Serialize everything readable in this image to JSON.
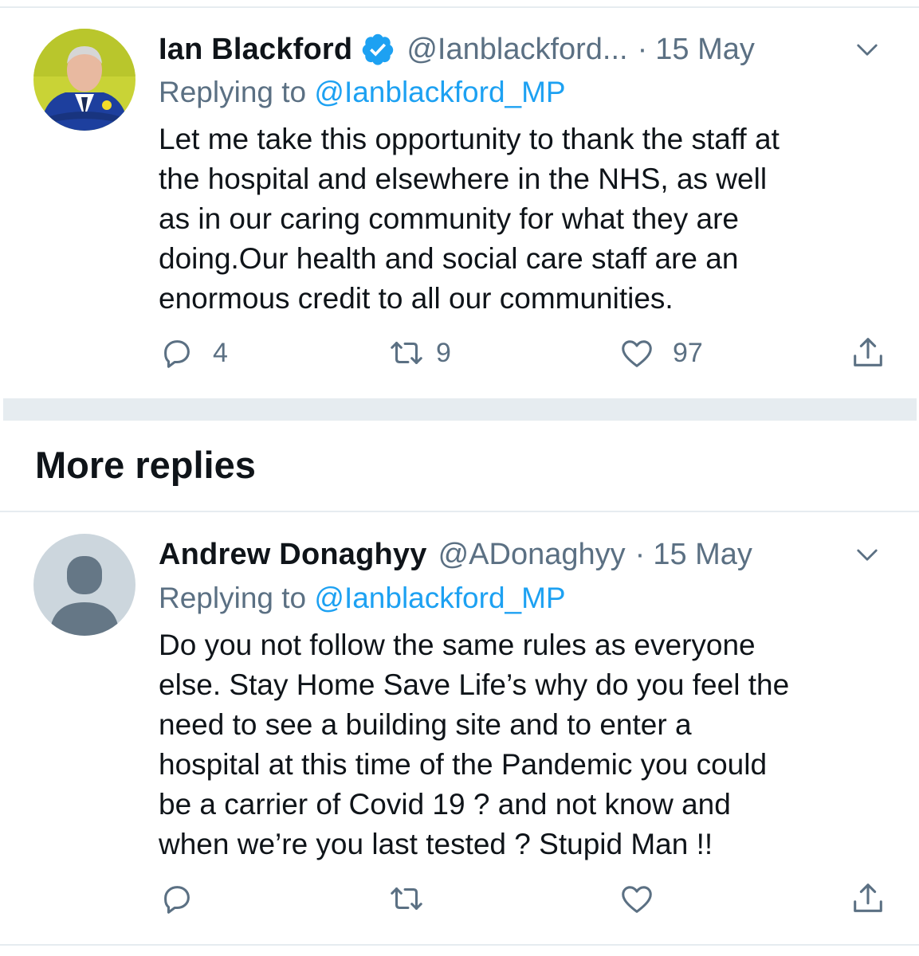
{
  "tweet1": {
    "name": "Ian Blackford",
    "handle": "@Ianblackford...",
    "separator": "·",
    "date": "15 May",
    "replying_prefix": "Replying to ",
    "replying_to": "@Ianblackford_MP",
    "lines": [
      "Let me take this opportunity to thank the staff at",
      "the hospital and elsewhere in the NHS, as well",
      "as in our caring community for what they are",
      "doing.Our health and social care staff are an",
      "enormous credit to all our communities."
    ],
    "reply_count": "4",
    "retweet_count": "9",
    "like_count": "97",
    "icons": [
      "verified-badge-icon",
      "chevron-down-icon",
      "reply-icon",
      "retweet-icon",
      "like-icon",
      "share-icon"
    ]
  },
  "section": {
    "title": "More replies"
  },
  "tweet2": {
    "name": "Andrew Donaghyy",
    "handle": "@ADonaghyy",
    "separator": "·",
    "date": "15 May",
    "replying_prefix": "Replying to ",
    "replying_to": "@Ianblackford_MP",
    "lines": [
      "Do you not follow the same rules as everyone",
      "else. Stay Home Save Life’s why do you feel the",
      "need to see a building site and to enter a",
      "hospital at this time of the Pandemic you could",
      "be a carrier of Covid 19 ? and not know and",
      "when we’re you last tested ? Stupid Man !!"
    ],
    "icons": [
      "default-avatar-icon",
      "chevron-down-icon",
      "reply-icon",
      "retweet-icon",
      "like-icon",
      "share-icon"
    ]
  },
  "colors": {
    "link": "#1da1f2",
    "secondary_text": "#5b7083",
    "divider": "#e6ecf0",
    "avatar_bg_1": "#c9d336",
    "default_avatar_bg": "#ccd6dd",
    "default_avatar_fg": "#657786"
  }
}
